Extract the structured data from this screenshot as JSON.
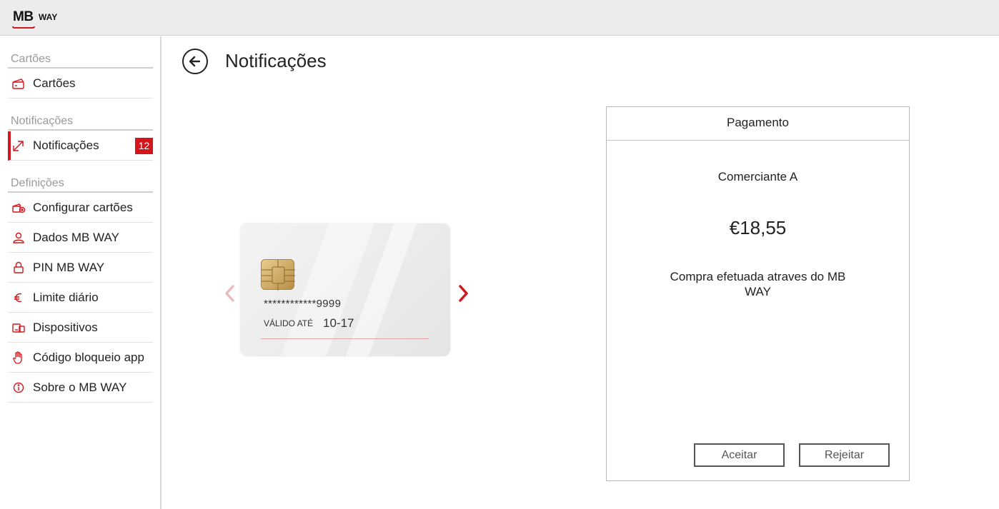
{
  "app": {
    "logo_mb": "MB",
    "logo_way": "WAY"
  },
  "sidebar": {
    "sections": [
      {
        "title": "Cartões"
      },
      {
        "title": "Notificações"
      },
      {
        "title": "Definições"
      }
    ],
    "items": [
      {
        "label": "Cartões",
        "icon": "card-icon"
      },
      {
        "label": "Notificações",
        "icon": "notifications-icon",
        "badge": "12",
        "active": true
      },
      {
        "label": "Configurar cartões",
        "icon": "card-settings-icon"
      },
      {
        "label": "Dados MB WAY",
        "icon": "user-icon"
      },
      {
        "label": "PIN MB WAY",
        "icon": "lock-icon"
      },
      {
        "label": "Limite diário",
        "icon": "euro-icon"
      },
      {
        "label": "Dispositivos",
        "icon": "devices-icon"
      },
      {
        "label": "Código bloqueio app",
        "icon": "hand-icon"
      },
      {
        "label": "Sobre o MB WAY",
        "icon": "info-icon"
      }
    ]
  },
  "main": {
    "title": "Notificações",
    "card": {
      "number": "************9999",
      "valid_label": "VÁLIDO ATÉ",
      "valid_value": "10-17"
    }
  },
  "payment": {
    "header": "Pagamento",
    "merchant": "Comerciante A",
    "amount": "€18,55",
    "description": "Compra efetuada atraves do MB WAY",
    "accept_label": "Aceitar",
    "reject_label": "Rejeitar"
  },
  "colors": {
    "accent": "#d2161b",
    "topbar": "#ececec"
  }
}
